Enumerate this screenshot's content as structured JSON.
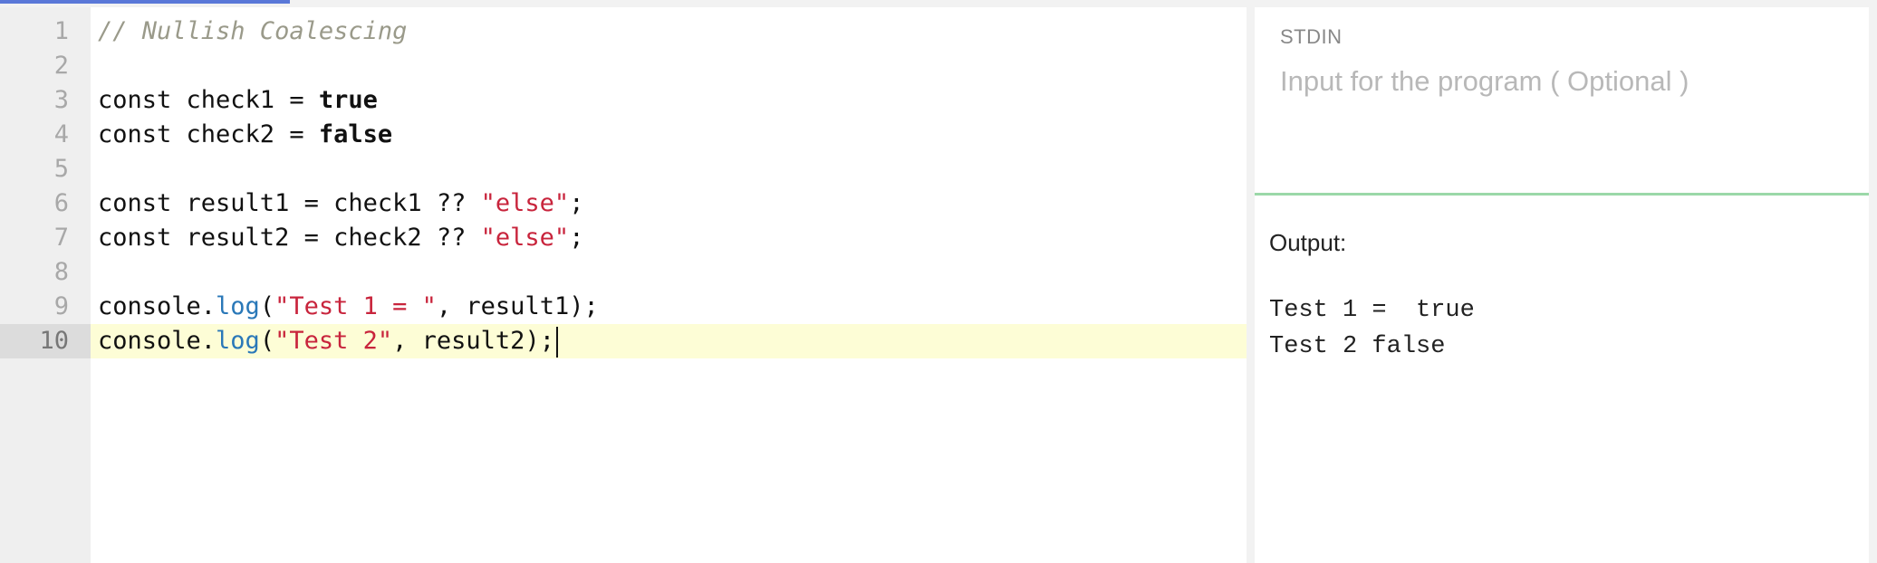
{
  "editor": {
    "active_line": 10,
    "lines": [
      {
        "number": "1",
        "tokens": [
          {
            "text": "// Nullish Coalescing",
            "kind": "comment"
          }
        ]
      },
      {
        "number": "2",
        "tokens": []
      },
      {
        "number": "3",
        "tokens": [
          {
            "text": "const check1 = ",
            "kind": "plain"
          },
          {
            "text": "true",
            "kind": "kw"
          }
        ]
      },
      {
        "number": "4",
        "tokens": [
          {
            "text": "const check2 = ",
            "kind": "plain"
          },
          {
            "text": "false",
            "kind": "kw"
          }
        ]
      },
      {
        "number": "5",
        "tokens": []
      },
      {
        "number": "6",
        "tokens": [
          {
            "text": "const result1 = check1 ?? ",
            "kind": "plain"
          },
          {
            "text": "\"else\"",
            "kind": "str"
          },
          {
            "text": ";",
            "kind": "plain"
          }
        ]
      },
      {
        "number": "7",
        "tokens": [
          {
            "text": "const result2 = check2 ?? ",
            "kind": "plain"
          },
          {
            "text": "\"else\"",
            "kind": "str"
          },
          {
            "text": ";",
            "kind": "plain"
          }
        ]
      },
      {
        "number": "8",
        "tokens": []
      },
      {
        "number": "9",
        "tokens": [
          {
            "text": "console.",
            "kind": "plain"
          },
          {
            "text": "log",
            "kind": "prop"
          },
          {
            "text": "(",
            "kind": "plain"
          },
          {
            "text": "\"Test 1 = \"",
            "kind": "str"
          },
          {
            "text": ", result1);",
            "kind": "plain"
          }
        ]
      },
      {
        "number": "10",
        "tokens": [
          {
            "text": "console.",
            "kind": "plain"
          },
          {
            "text": "log",
            "kind": "prop"
          },
          {
            "text": "(",
            "kind": "plain"
          },
          {
            "text": "\"Test 2\"",
            "kind": "str"
          },
          {
            "text": ", result2);",
            "kind": "plain"
          }
        ]
      }
    ]
  },
  "stdin": {
    "label": "STDIN",
    "placeholder": "Input for the program ( Optional )"
  },
  "output": {
    "label": "Output:",
    "lines": [
      "Test 1 =  true",
      "Test 2 false"
    ]
  },
  "colors": {
    "progress_bar": "#5a78d8",
    "stdin_divider": "#9bd8a8",
    "active_line_bg": "#fdfdd6",
    "string": "#c8243c",
    "property": "#2a78b8",
    "comment": "#9a9a8a"
  }
}
